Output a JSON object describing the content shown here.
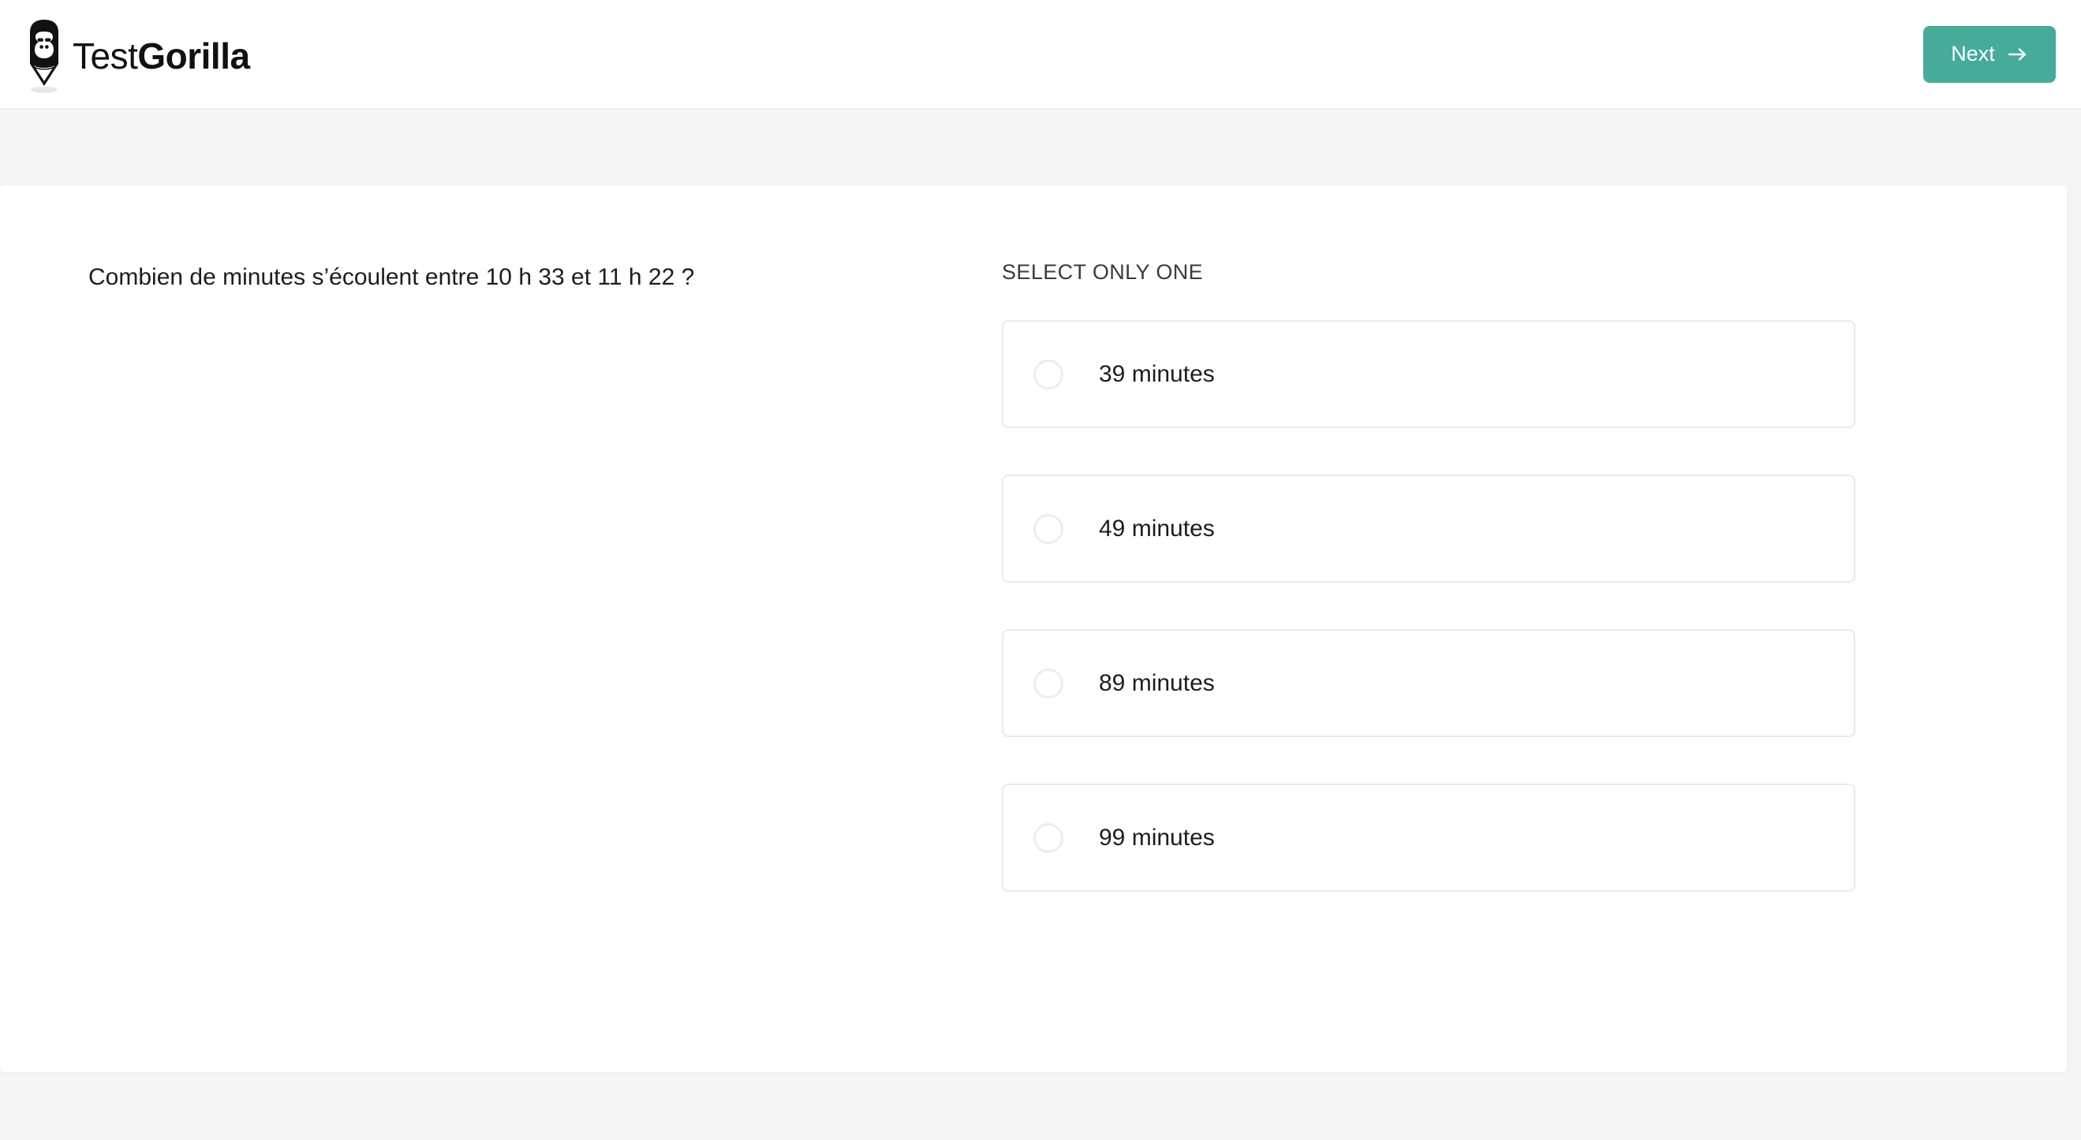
{
  "header": {
    "logo": {
      "icon": "gorilla-head-icon",
      "word_light": "Test",
      "word_bold": "Gorilla"
    },
    "next_label": "Next",
    "next_icon": "arrow-right-icon",
    "accent_color": "#46ab99"
  },
  "assessment": {
    "question": "Combien de minutes s’écoulent entre 10 h 33 et 11 h 22 ?",
    "select_hint": "SELECT ONLY ONE",
    "options": [
      {
        "label": "39 minutes",
        "selected": false
      },
      {
        "label": "49 minutes",
        "selected": false
      },
      {
        "label": "89 minutes",
        "selected": false
      },
      {
        "label": "99 minutes",
        "selected": false
      }
    ]
  },
  "colors": {
    "page_background": "#f4f6f6",
    "sheet_background": "#ffffff",
    "card_border": "#e9eaea",
    "radio_border": "#ededed",
    "text_primary": "#1d1d1d"
  }
}
